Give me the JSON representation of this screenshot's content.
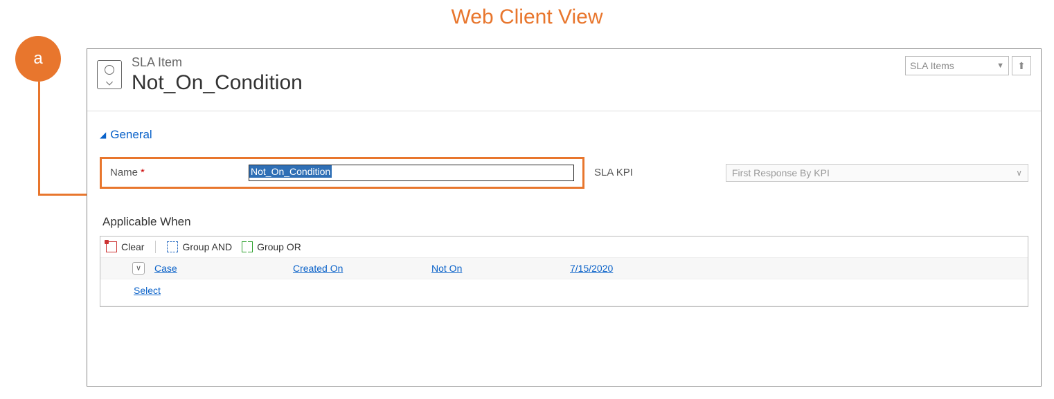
{
  "page_heading": "Web Client View",
  "annotation": {
    "badge": "a"
  },
  "header": {
    "entity_label": "SLA Item",
    "record_name": "Not_On_Condition",
    "form_selector": "SLA Items"
  },
  "general": {
    "section_title": "General",
    "name_label": "Name",
    "name_value": "Not_On_Condition",
    "kpi_label": "SLA KPI",
    "kpi_value": "First Response By KPI"
  },
  "applicable_when": {
    "heading": "Applicable When",
    "toolbar": {
      "clear": "Clear",
      "group_and": "Group AND",
      "group_or": "Group OR"
    },
    "row": {
      "entity": "Case",
      "attribute": "Created On",
      "operator": "Not On",
      "value": "7/15/2020"
    },
    "select_label": "Select"
  }
}
